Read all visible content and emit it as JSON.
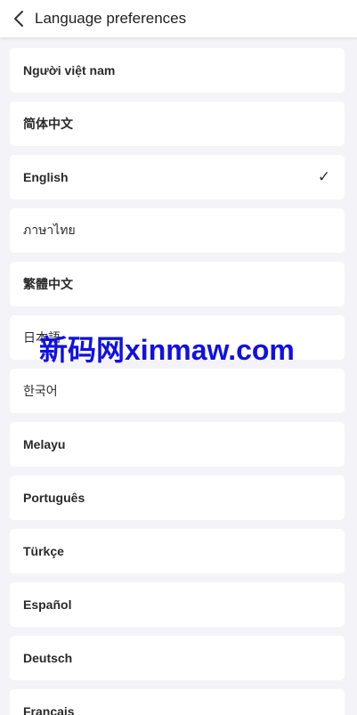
{
  "header": {
    "title": "Language preferences",
    "back_icon": "chevron-left-icon"
  },
  "languages": [
    {
      "label": "Người việt nam",
      "selected": false
    },
    {
      "label": "简体中文",
      "selected": false
    },
    {
      "label": "English",
      "selected": true
    },
    {
      "label": "ภาษาไทย",
      "selected": false
    },
    {
      "label": "繁體中文",
      "selected": false
    },
    {
      "label": "日本語",
      "selected": false
    },
    {
      "label": "한국어",
      "selected": false
    },
    {
      "label": "Melayu",
      "selected": false
    },
    {
      "label": "Português",
      "selected": false
    },
    {
      "label": "Türkçe",
      "selected": false
    },
    {
      "label": "Español",
      "selected": false
    },
    {
      "label": "Deutsch",
      "selected": false
    },
    {
      "label": "Français",
      "selected": false
    }
  ],
  "check_mark": "✓",
  "watermark": "新码网xinmaw.com"
}
